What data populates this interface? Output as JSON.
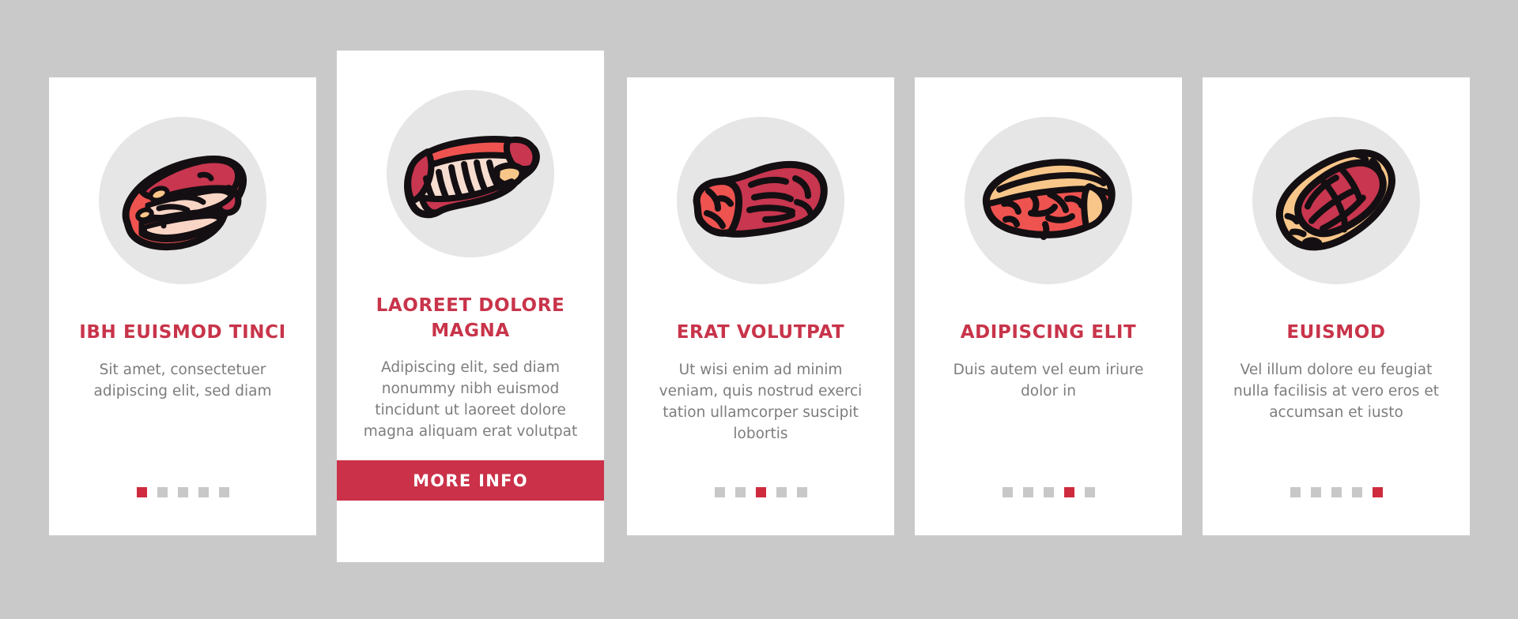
{
  "background_color": "#c9c9c9",
  "accent_color": "#c8344a",
  "button_color": "#cb3148",
  "dot_inactive_color": "#c8c8c8",
  "dot_active_color": "#cf2b3e",
  "disc_color": "#e6e6e6",
  "body_text_color": "#7d7d7d",
  "cards": [
    {
      "id": "card-1",
      "featured": false,
      "icon": "steak-slab-icon",
      "title": "IBH EUISMOD TINCI",
      "description": "Sit amet, consectetuer adipiscing elit, sed diam",
      "pager": {
        "total": 5,
        "active_index": 0
      },
      "cta": null
    },
    {
      "id": "card-2",
      "featured": true,
      "icon": "rib-rack-icon",
      "title": "LAOREET DOLORE MAGNA",
      "description": "Adipiscing elit, sed diam nonummy nibh euismod tincidunt ut laoreet dolore magna aliquam erat volutpat",
      "pager": null,
      "cta": "MORE INFO"
    },
    {
      "id": "card-3",
      "featured": false,
      "icon": "beef-roll-icon",
      "title": "ERAT VOLUTPAT",
      "description": "Ut wisi enim ad minim veniam, quis nostrud exerci tation ullamcorper suscipit lobortis",
      "pager": {
        "total": 5,
        "active_index": 2
      },
      "cta": null
    },
    {
      "id": "card-4",
      "featured": false,
      "icon": "fatty-steak-icon",
      "title": "ADIPISCING ELIT",
      "description": "Duis autem vel eum iriure dolor in",
      "pager": {
        "total": 5,
        "active_index": 3
      },
      "cta": null
    },
    {
      "id": "card-5",
      "featured": false,
      "icon": "marbled-steak-icon",
      "title": "EUISMOD",
      "description": "Vel illum dolore eu feugiat nulla facilisis at vero eros et accumsan et iusto",
      "pager": {
        "total": 5,
        "active_index": 4
      },
      "cta": null
    }
  ]
}
